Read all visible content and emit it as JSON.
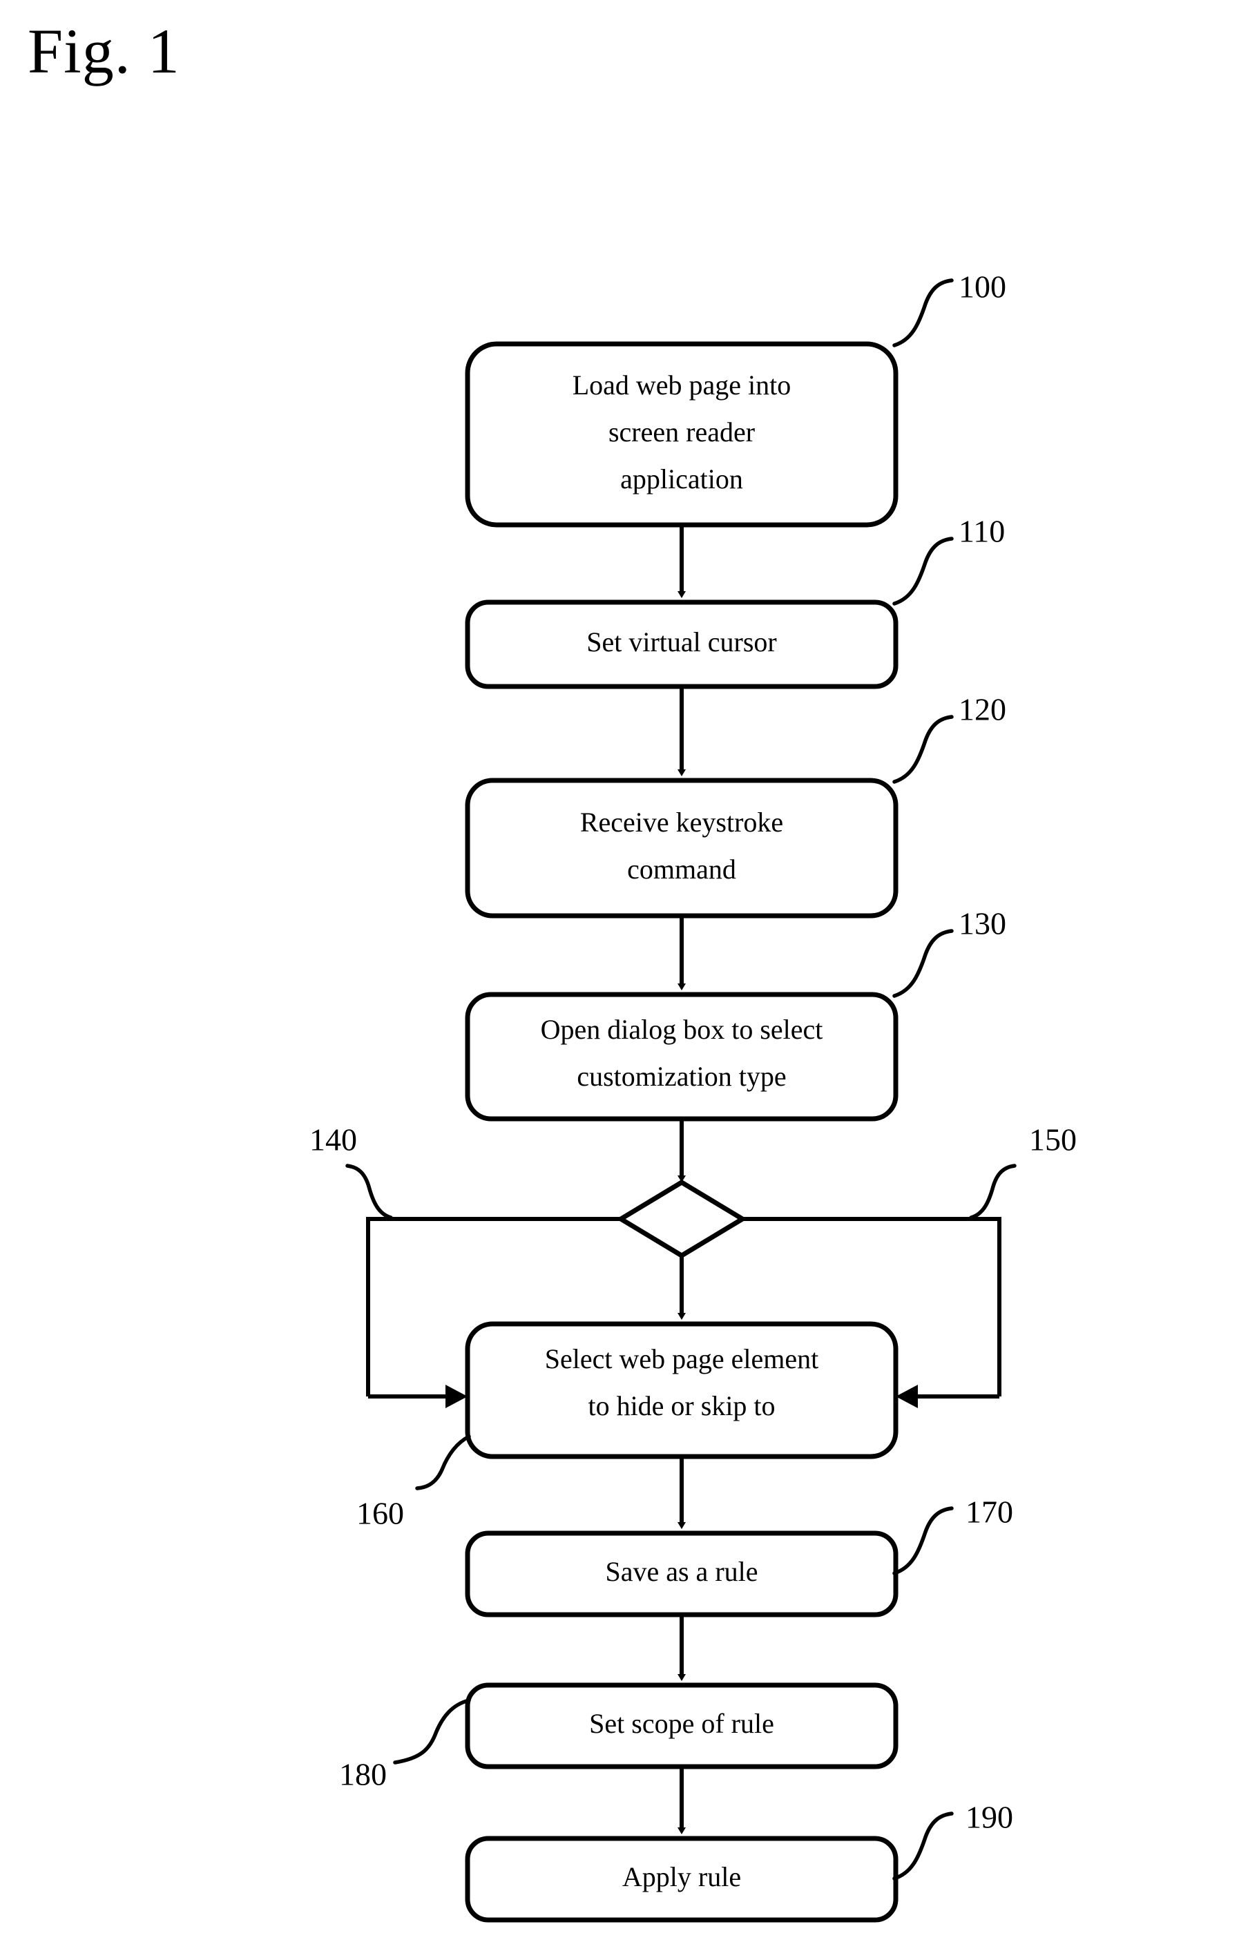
{
  "figure": {
    "title": "Fig. 1",
    "type": "process-flowchart"
  },
  "chart_data": {
    "type": "diagram",
    "title": "Fig. 1",
    "nodes": [
      {
        "ref": "100",
        "shape": "rounded-rectangle",
        "text": "Load web page into screen reader application",
        "lines": [
          "Load web page into",
          "screen reader",
          "application"
        ]
      },
      {
        "ref": "110",
        "shape": "rounded-rectangle",
        "text": "Set virtual cursor",
        "lines": [
          "Set virtual cursor"
        ]
      },
      {
        "ref": "120",
        "shape": "rounded-rectangle",
        "text": "Receive keystroke command",
        "lines": [
          "Receive keystroke",
          "command"
        ]
      },
      {
        "ref": "130",
        "shape": "rounded-rectangle",
        "text": "Open dialog box to select customization type",
        "lines": [
          "Open dialog box to select",
          "customization type"
        ]
      },
      {
        "ref": "",
        "shape": "diamond",
        "text": "",
        "lines": []
      },
      {
        "ref": "160",
        "shape": "rounded-rectangle",
        "text": "Select web page element to hide or skip to",
        "lines": [
          "Select web page element",
          "to hide or skip to"
        ]
      },
      {
        "ref": "170",
        "shape": "rounded-rectangle",
        "text": "Save as a rule",
        "lines": [
          "Save as a rule"
        ]
      },
      {
        "ref": "180",
        "shape": "rounded-rectangle",
        "text": "Set scope of rule",
        "lines": [
          "Set scope of rule"
        ]
      },
      {
        "ref": "190",
        "shape": "rounded-rectangle",
        "text": "Apply rule",
        "lines": [
          "Apply rule"
        ]
      }
    ],
    "branch_refs": [
      {
        "ref": "140",
        "side": "left",
        "description": "left branch path from decision diamond into select-element step"
      },
      {
        "ref": "150",
        "side": "right",
        "description": "right branch path from decision diamond into select-element step"
      }
    ],
    "edges": [
      {
        "from": "100",
        "to": "110",
        "style": "arrow-down"
      },
      {
        "from": "110",
        "to": "120",
        "style": "arrow-down"
      },
      {
        "from": "120",
        "to": "130",
        "style": "arrow-down"
      },
      {
        "from": "130",
        "to": "diamond",
        "style": "arrow-down"
      },
      {
        "from": "diamond",
        "to": "160",
        "style": "arrow-down"
      },
      {
        "from": "diamond",
        "to": "160",
        "style": "left-branch-arrow-right"
      },
      {
        "from": "diamond",
        "to": "160",
        "style": "right-branch-arrow-left"
      },
      {
        "from": "160",
        "to": "170",
        "style": "arrow-down"
      },
      {
        "from": "170",
        "to": "180",
        "style": "arrow-down"
      },
      {
        "from": "180",
        "to": "190",
        "style": "arrow-down"
      }
    ],
    "colors": {
      "stroke": "#000000",
      "fill": "#ffffff",
      "background": "#ffffff"
    }
  },
  "nodes": {
    "n100": {
      "ref": "100",
      "line1": "Load web page into",
      "line2": "screen reader",
      "line3": "application"
    },
    "n110": {
      "ref": "110",
      "line1": "Set virtual cursor"
    },
    "n120": {
      "ref": "120",
      "line1": "Receive keystroke",
      "line2": "command"
    },
    "n130": {
      "ref": "130",
      "line1": "Open dialog box to select",
      "line2": "customization type"
    },
    "n140": {
      "ref": "140"
    },
    "n150": {
      "ref": "150"
    },
    "n160": {
      "ref": "160",
      "line1": "Select web page element",
      "line2": "to hide or skip to"
    },
    "n170": {
      "ref": "170",
      "line1": "Save as a rule"
    },
    "n180": {
      "ref": "180",
      "line1": "Set scope of rule"
    },
    "n190": {
      "ref": "190",
      "line1": "Apply rule"
    }
  }
}
